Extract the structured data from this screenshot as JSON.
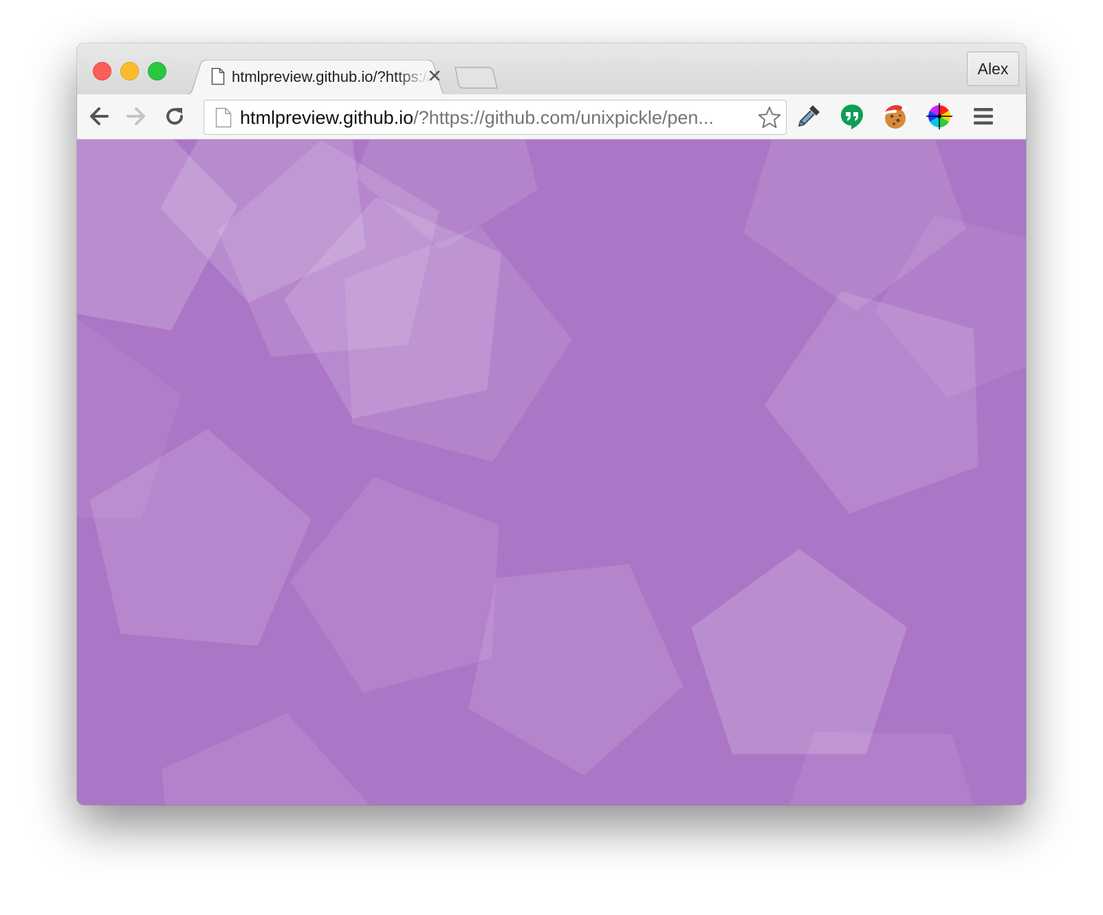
{
  "window": {
    "controls": [
      "close",
      "minimize",
      "maximize"
    ]
  },
  "tab": {
    "title": "htmlpreview.github.io/?https://github.com/unixpickle/pentagons",
    "icon": "document-icon",
    "close_symbol": "×"
  },
  "profile": {
    "name": "Alex"
  },
  "toolbar": {
    "back": "back-arrow-icon",
    "forward": "forward-arrow-icon",
    "reload": "reload-icon",
    "url_host": "htmlpreview.github.io",
    "url_rest": "/?https://github.com/unixpickle/pen...",
    "bookmark": "star-icon",
    "extensions": [
      "eyedropper-icon",
      "hangouts-icon",
      "cookie-icon",
      "color-wheel-icon"
    ],
    "menu": "hamburger-menu-icon"
  },
  "page": {
    "background_color": "#ac76c6",
    "shape_color": "#ffffff",
    "shape": "pentagon"
  }
}
